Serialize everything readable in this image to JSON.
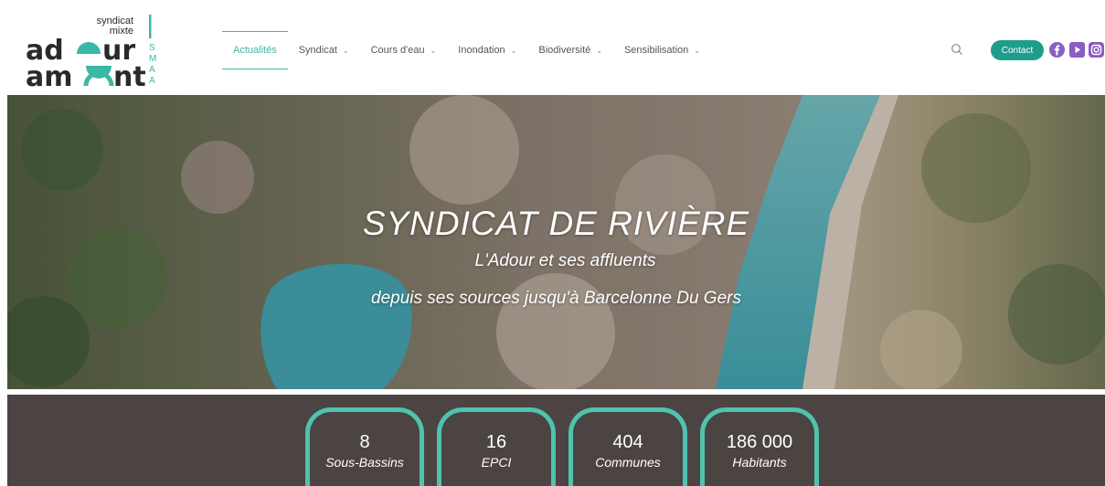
{
  "logo": {
    "line1": "syndicat",
    "line2": "mixte",
    "word1": "ad",
    "word1b": "ur",
    "word2": "am",
    "word2b": "nt",
    "side": [
      "S",
      "M",
      "A",
      "A"
    ]
  },
  "nav": {
    "items": [
      {
        "label": "Actualités",
        "has_dropdown": false
      },
      {
        "label": "Syndicat",
        "has_dropdown": true
      },
      {
        "label": "Cours d'eau",
        "has_dropdown": true
      },
      {
        "label": "Inondation",
        "has_dropdown": true
      },
      {
        "label": "Biodiversité",
        "has_dropdown": true
      },
      {
        "label": "Sensibilisation",
        "has_dropdown": true
      }
    ],
    "chevron": "⌄"
  },
  "header": {
    "contact_label": "Contact",
    "icons": [
      "search-icon",
      "facebook-icon",
      "youtube-icon",
      "instagram-icon"
    ]
  },
  "hero": {
    "title": "SYNDICAT DE RIVIÈRE",
    "subtitle1": "L'Adour et ses affluents",
    "subtitle2": "depuis ses sources jusqu'à Barcelonne Du Gers"
  },
  "stats": [
    {
      "value": "8",
      "label": "Sous-Bassins"
    },
    {
      "value": "16",
      "label": "EPCI"
    },
    {
      "value": "404",
      "label": "Communes"
    },
    {
      "value": "186 000",
      "label": "Habitants"
    }
  ],
  "colors": {
    "accent": "#3bb8a6",
    "contact_bg": "#1f9d8c",
    "social": "#8a5cc4",
    "stats_bg": "#4b4443",
    "stats_border": "#4fc3ad",
    "logo_text": "#2a2a2a"
  }
}
